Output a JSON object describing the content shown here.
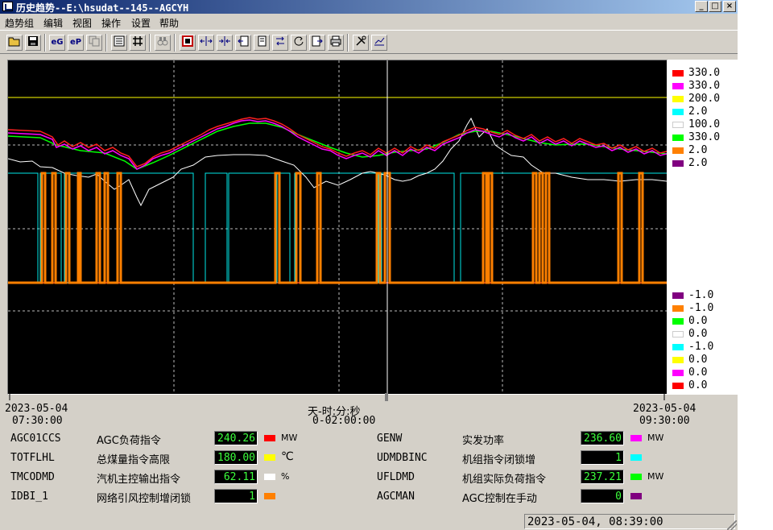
{
  "window": {
    "title": "历史趋势--E:\\hsudat--145--AGCYH"
  },
  "menu": [
    "趋势组",
    "编辑",
    "视图",
    "操作",
    "设置",
    "帮助"
  ],
  "toolbar_icons": [
    "open-folder-icon",
    "save-icon",
    "eg-icon",
    "ep-icon",
    "copy-icon",
    "list-icon",
    "grid-icon",
    "binoculars-icon",
    "zoom-box-icon",
    "expand-h-icon",
    "compress-h-icon",
    "page-back-icon",
    "page-icon",
    "swap-icon",
    "reload-icon",
    "page-forward-icon",
    "printer-icon",
    "tools-icon",
    "chart-settings-icon"
  ],
  "scales_top": [
    {
      "value": "330.0",
      "color": "#ff0000"
    },
    {
      "value": "330.0",
      "color": "#ff00ff"
    },
    {
      "value": "200.0",
      "color": "#ffff00"
    },
    {
      "value": "2.0",
      "color": "#00ffff"
    },
    {
      "value": "100.0",
      "color": "#ffffff"
    },
    {
      "value": "330.0",
      "color": "#00ff00"
    },
    {
      "value": "2.0",
      "color": "#ff8000"
    },
    {
      "value": "2.0",
      "color": "#800080"
    }
  ],
  "scales_bottom": [
    {
      "value": "-1.0",
      "color": "#800080"
    },
    {
      "value": "-1.0",
      "color": "#ff8000"
    },
    {
      "value": "0.0",
      "color": "#00ff00"
    },
    {
      "value": "0.0",
      "color": "#ffffff"
    },
    {
      "value": "-1.0",
      "color": "#00ffff"
    },
    {
      "value": "0.0",
      "color": "#ffff00"
    },
    {
      "value": "0.0",
      "color": "#ff00ff"
    },
    {
      "value": "0.0",
      "color": "#ff0000"
    }
  ],
  "time_axis": {
    "start_date": "2023-05-04",
    "start_time": "07:30:00",
    "end_date": "2023-05-04",
    "end_time": "09:30:00",
    "unit_label": "天-时:分:秒",
    "span": "0-02:00:00"
  },
  "tags": [
    {
      "id": "AGC01CCS",
      "desc": "AGC负荷指令",
      "value": "240.26",
      "unit": "MW",
      "color": "#ff0000"
    },
    {
      "id": "TOTFLHL",
      "desc": "总煤量指令高限",
      "value": "180.00",
      "unit": "℃",
      "color": "#ffff00"
    },
    {
      "id": "TMCODMD",
      "desc": "汽机主控输出指令",
      "value": "62.11",
      "unit": "%",
      "color": "#ffffff"
    },
    {
      "id": "IDBI_1",
      "desc": "网络引风控制增闭锁",
      "value": "1",
      "unit": "",
      "color": "#ff8000"
    },
    {
      "id": "GENW",
      "desc": "实发功率",
      "value": "236.60",
      "unit": "MW",
      "color": "#ff00ff"
    },
    {
      "id": "UDMDBINC",
      "desc": "机组指令闭锁增",
      "value": "1",
      "unit": "",
      "color": "#00ffff"
    },
    {
      "id": "UFLDMD",
      "desc": "机组实际负荷指令",
      "value": "237.21",
      "unit": "MW",
      "color": "#00ff00"
    },
    {
      "id": "AGCMAN",
      "desc": "AGC控制在手动",
      "value": "0",
      "unit": "",
      "color": "#800080"
    }
  ],
  "status": {
    "cursor_time": "2023-05-04, 08:39:00"
  }
}
